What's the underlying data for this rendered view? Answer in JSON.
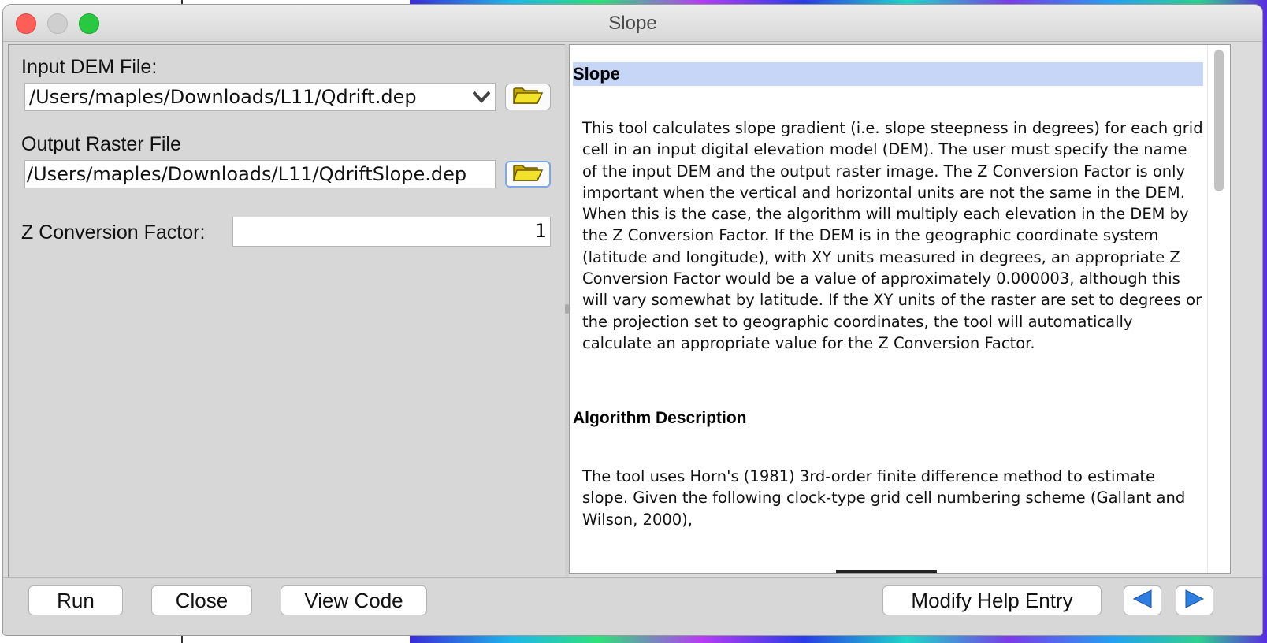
{
  "window": {
    "title": "Slope"
  },
  "form": {
    "input_dem_label": "Input DEM File:",
    "input_dem_value": "/Users/maples/Downloads/L11/Qdrift.dep",
    "output_raster_label": "Output Raster File",
    "output_raster_value": "/Users/maples/Downloads/L11/QdriftSlope.dep",
    "z_factor_label": "Z Conversion Factor:",
    "z_factor_value": "1"
  },
  "help": {
    "heading": "Slope",
    "paragraph1": "This tool calculates slope gradient (i.e. slope steepness in degrees) for each grid cell in an input digital elevation model (DEM). The user must specify the name of the input DEM and the output raster image. The Z Conversion Factor is only important when the vertical and horizontal units are not the same in the DEM. When this is the case, the algorithm will multiply each elevation in the DEM by the Z Conversion Factor. If the DEM is in the geographic coordinate system (latitude and longitude), with XY units measured in degrees, an appropriate Z Conversion Factor would be a value of approximately 0.000003, although this will vary somewhat by latitude. If the XY units of the raster are set to degrees or the projection set to geographic coordinates, the tool will automatically calculate an appropriate value for the Z Conversion Factor.",
    "subheading": "Algorithm Description",
    "paragraph2": "The tool uses Horn's (1981) 3rd-order finite difference method to estimate slope. Given the following clock-type grid cell numbering scheme (Gallant and Wilson, 2000),"
  },
  "buttons": {
    "run": "Run",
    "close": "Close",
    "view_code": "View Code",
    "modify_help": "Modify Help Entry"
  },
  "icons": {
    "folder": "folder-open-icon",
    "dropdown": "chevron-down-icon",
    "back": "left-arrow-icon",
    "forward": "right-arrow-icon"
  }
}
